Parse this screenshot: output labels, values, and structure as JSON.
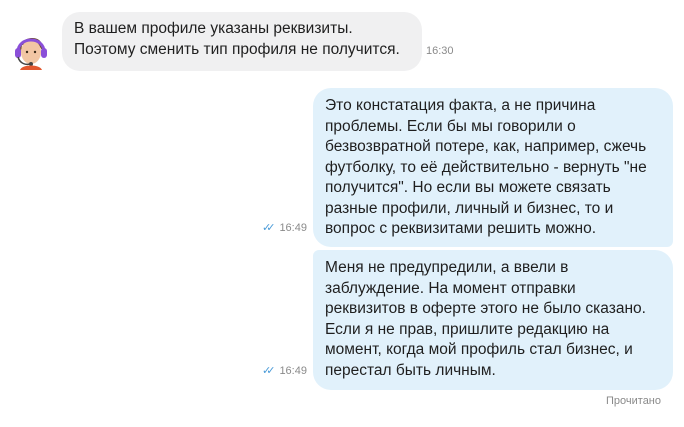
{
  "messages": [
    {
      "direction": "incoming",
      "text": "В вашем профиле указаны реквизиты.\nПоэтому сменить тип профиля не получится.",
      "time": "16:30"
    },
    {
      "direction": "outgoing",
      "text": "Это констатация факта, а не причина\nпроблемы. Если бы мы говорили о\nбезвозвратной потере, как, например, сжечь\nфутболку, то её действительно - вернуть \"не\nполучится\". Но если вы можете связать\nразные профили, личный и бизнес, то и\nвопрос с реквизитами решить можно.",
      "time": "16:49",
      "status_icon": "double-check-icon"
    },
    {
      "direction": "outgoing",
      "text": "Меня не предупредили, а ввели в\nзаблуждение. На момент отправки\nреквизитов в оферте этого не было сказано.\nЕсли я не прав, пришлите редакцию на\nмомент, когда мой профиль стал бизнес, и\nперестал быть личным.",
      "time": "16:49",
      "status_icon": "double-check-icon"
    }
  ],
  "read_status": "Прочитано",
  "colors": {
    "incoming_bubble": "#f0f0f1",
    "outgoing_bubble": "#e1f1fb",
    "check_mark": "#4a9bd8",
    "avatar_headset": "#8a4fd8"
  },
  "avatar": {
    "icon": "support-agent-avatar-icon"
  }
}
